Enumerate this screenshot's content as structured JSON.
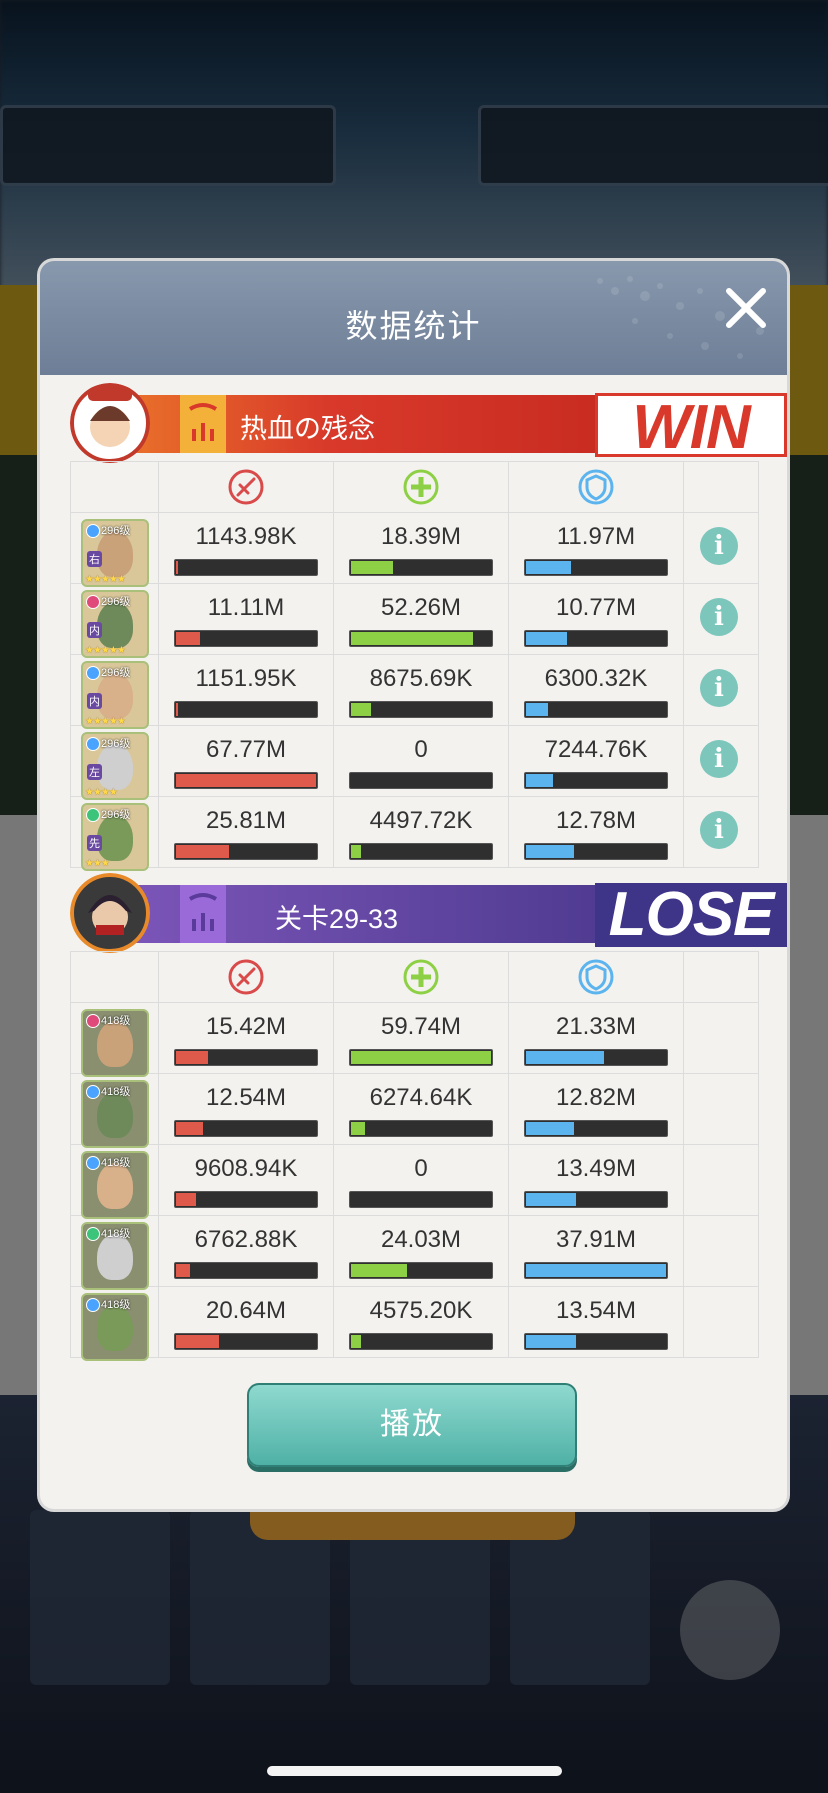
{
  "dialog": {
    "title": "数据统计"
  },
  "colors": {
    "damage": "#e05a4c",
    "heal": "#8ed045",
    "defense": "#5cb4ef",
    "win_strip": "#d8392a",
    "lose_strip": "#4d3a8f"
  },
  "columns": {
    "damage_icon": "sword-icon",
    "heal_icon": "plus-icon",
    "defense_icon": "shield-icon"
  },
  "teams": [
    {
      "name": "热血の残念",
      "result": "WIN",
      "heroes": [
        {
          "level": "296级",
          "badge": "右",
          "stars": 5,
          "damage": "1143.98K",
          "damage_pct": 1,
          "heal": "18.39M",
          "heal_pct": 30,
          "defense": "11.97M",
          "defense_pct": 32,
          "has_info": true
        },
        {
          "level": "296级",
          "badge": "内",
          "stars": 5,
          "damage": "11.11M",
          "damage_pct": 17,
          "heal": "52.26M",
          "heal_pct": 87,
          "defense": "10.77M",
          "defense_pct": 29,
          "has_info": true
        },
        {
          "level": "296级",
          "badge": "内",
          "stars": 5,
          "damage": "1151.95K",
          "damage_pct": 1,
          "heal": "8675.69K",
          "heal_pct": 14,
          "defense": "6300.32K",
          "defense_pct": 16,
          "has_info": true
        },
        {
          "level": "296级",
          "badge": "左",
          "stars": 4,
          "damage": "67.77M",
          "damage_pct": 100,
          "heal": "0",
          "heal_pct": 0,
          "defense": "7244.76K",
          "defense_pct": 19,
          "has_info": true
        },
        {
          "level": "296级",
          "badge": "先",
          "stars": 3,
          "damage": "25.81M",
          "damage_pct": 38,
          "heal": "4497.72K",
          "heal_pct": 7,
          "defense": "12.78M",
          "defense_pct": 34,
          "has_info": true
        }
      ]
    },
    {
      "name": "关卡29-33",
      "result": "LOSE",
      "heroes": [
        {
          "level": "418级",
          "badge": "",
          "stars": 0,
          "damage": "15.42M",
          "damage_pct": 23,
          "heal": "59.74M",
          "heal_pct": 100,
          "defense": "21.33M",
          "defense_pct": 56,
          "has_info": false
        },
        {
          "level": "418级",
          "badge": "",
          "stars": 0,
          "damage": "12.54M",
          "damage_pct": 19,
          "heal": "6274.64K",
          "heal_pct": 10,
          "defense": "12.82M",
          "defense_pct": 34,
          "has_info": false
        },
        {
          "level": "418级",
          "badge": "",
          "stars": 0,
          "damage": "9608.94K",
          "damage_pct": 14,
          "heal": "0",
          "heal_pct": 0,
          "defense": "13.49M",
          "defense_pct": 36,
          "has_info": false
        },
        {
          "level": "418级",
          "badge": "",
          "stars": 0,
          "damage": "6762.88K",
          "damage_pct": 10,
          "heal": "24.03M",
          "heal_pct": 40,
          "defense": "37.91M",
          "defense_pct": 100,
          "has_info": false
        },
        {
          "level": "418级",
          "badge": "",
          "stars": 0,
          "damage": "20.64M",
          "damage_pct": 31,
          "heal": "4575.20K",
          "heal_pct": 7,
          "defense": "13.54M",
          "defense_pct": 36,
          "has_info": false
        }
      ]
    }
  ],
  "play_button": {
    "label": "播放"
  }
}
